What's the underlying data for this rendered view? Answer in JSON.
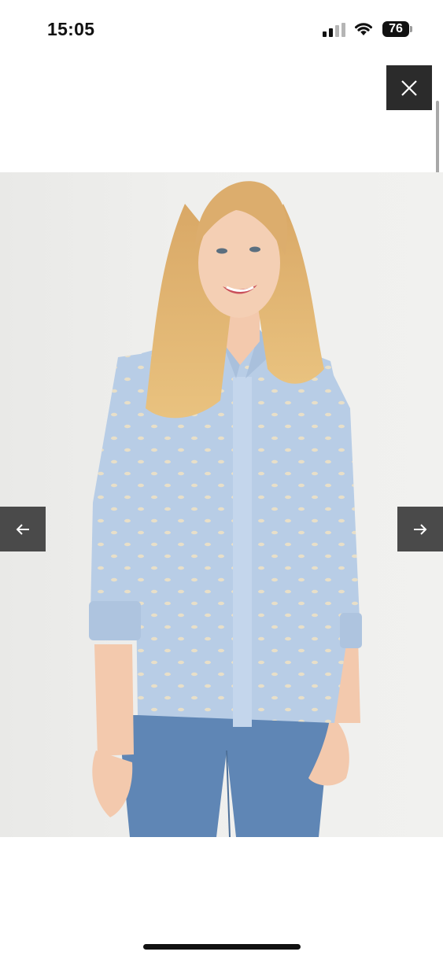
{
  "status_bar": {
    "time": "15:05",
    "battery_level": "76"
  },
  "viewer": {
    "close_icon": "close-icon",
    "prev_icon": "arrow-left-icon",
    "next_icon": "arrow-right-icon",
    "background_color": "#ffffff",
    "button_color": "#2b2b2b"
  },
  "product_image": {
    "shirt_color": "#b8cde6",
    "jeans_color": "#5f86b5",
    "wall_color": "#eeeeec"
  }
}
